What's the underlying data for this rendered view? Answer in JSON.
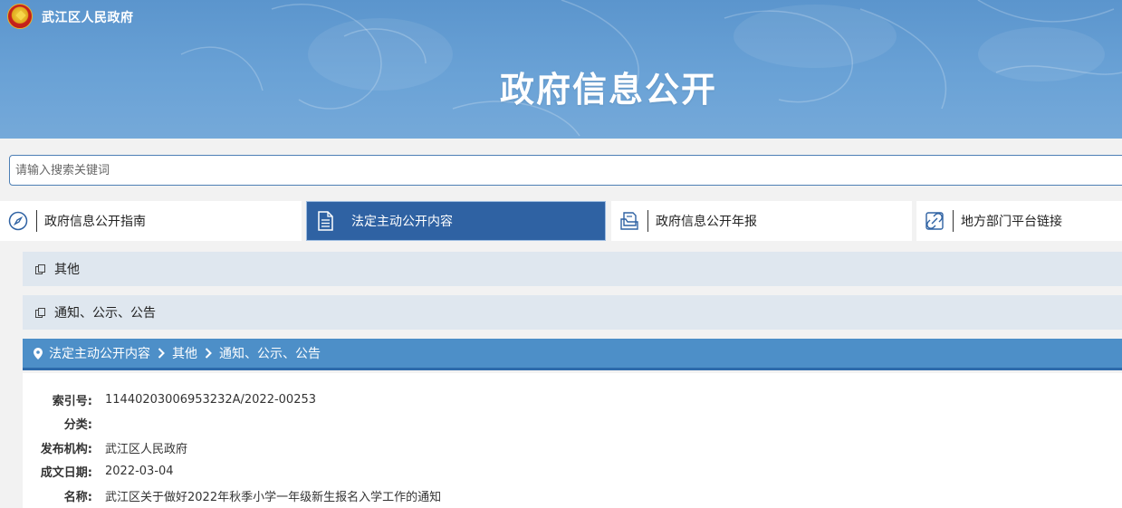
{
  "header": {
    "site_name": "武江区人民政府",
    "title": "政府信息公开"
  },
  "search": {
    "placeholder": "请输入搜索关键词"
  },
  "tabs": [
    {
      "label": "政府信息公开指南",
      "icon": "compass-icon",
      "active": false
    },
    {
      "label": "法定主动公开内容",
      "icon": "document-icon",
      "active": true
    },
    {
      "label": "政府信息公开年报",
      "icon": "report-stack-icon",
      "active": false
    },
    {
      "label": "地方部门平台链接",
      "icon": "link-icon",
      "active": false
    }
  ],
  "categories": [
    {
      "label": "其他",
      "icon": "copy-icon"
    },
    {
      "label": "通知、公示、公告",
      "icon": "copy-icon"
    }
  ],
  "breadcrumb": {
    "icon": "location-pin-icon",
    "items": [
      "法定主动公开内容",
      "其他",
      "通知、公示、公告"
    ]
  },
  "info": [
    {
      "key": "索引号:",
      "value": "11440203006953232A/2022-00253"
    },
    {
      "key": "分类:",
      "value": ""
    },
    {
      "key": "发布机构:",
      "value": "武江区人民政府"
    },
    {
      "key": "成文日期:",
      "value": "2022-03-04"
    },
    {
      "key": "名称:",
      "value": "武江区关于做好2022年秋季小学一年级新生报名入学工作的通知"
    }
  ],
  "colors": {
    "banner": "#6aa2d6",
    "active_tab": "#2f62a3",
    "breadcrumb": "#4d8fc8",
    "category_bg": "#dfe7ef"
  }
}
